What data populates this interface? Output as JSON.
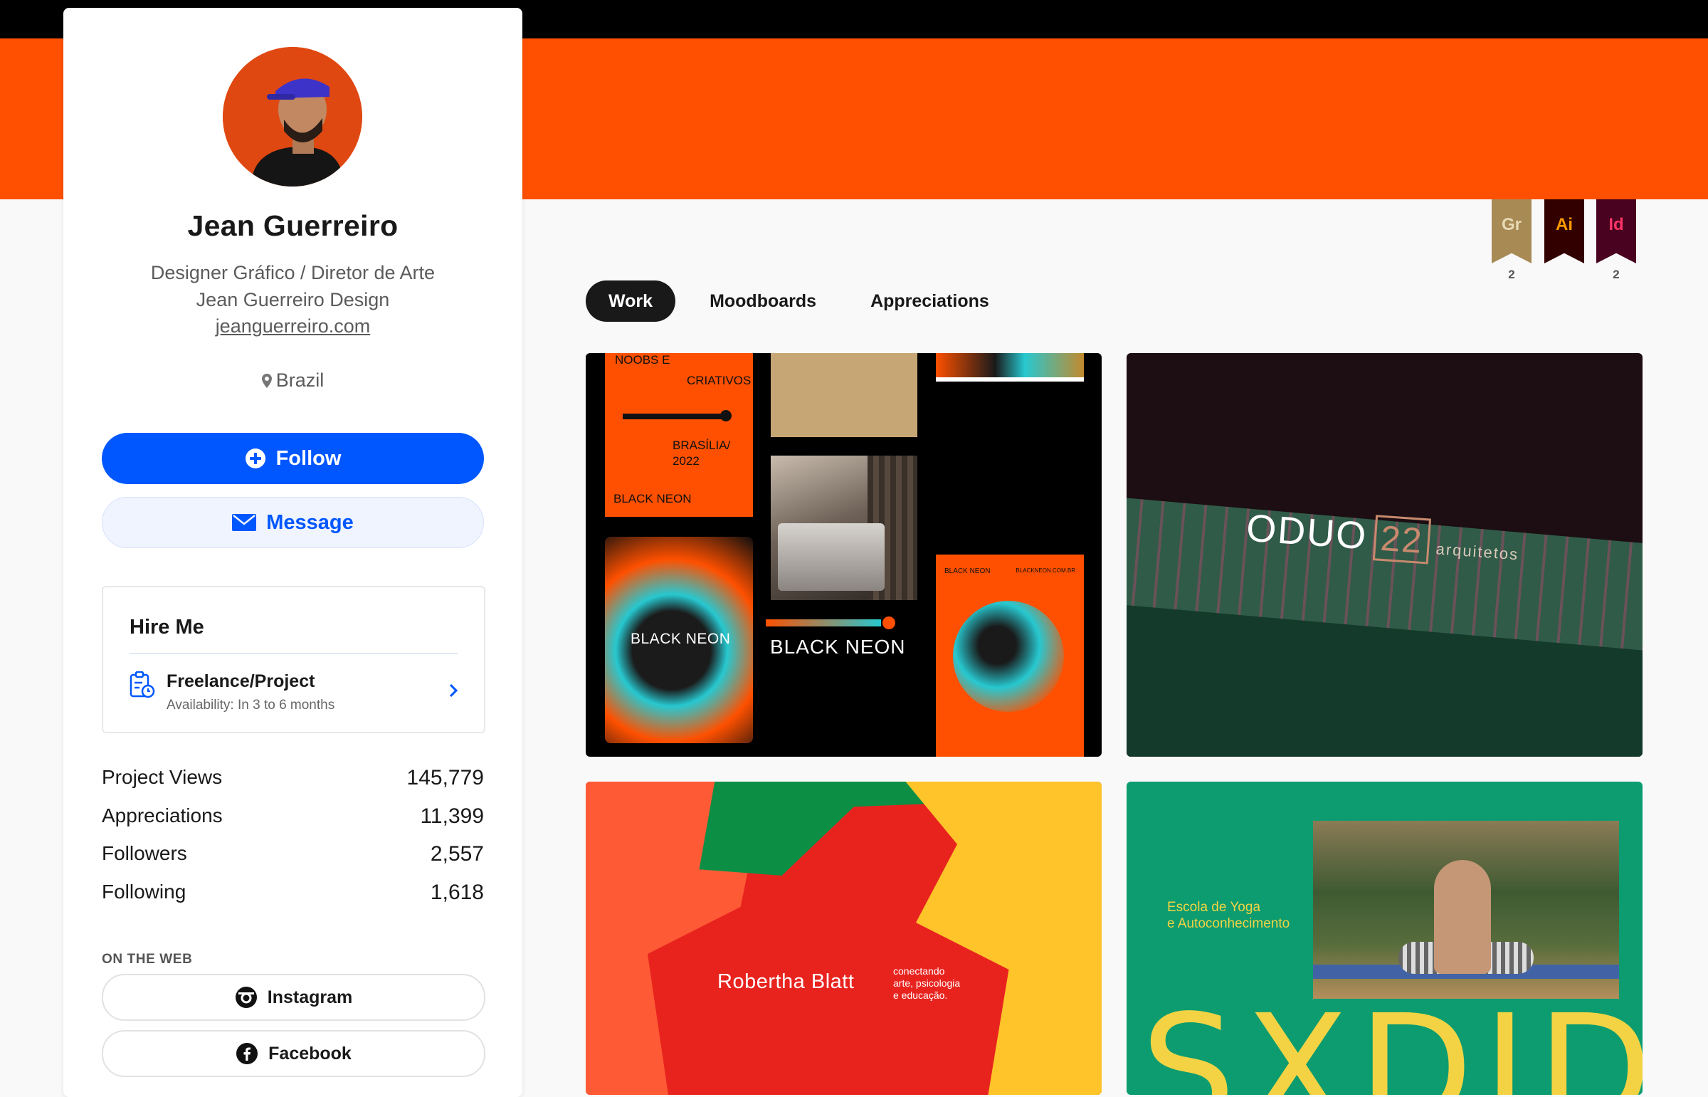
{
  "profile": {
    "name": "Jean Guerreiro",
    "occupation": "Designer Gráfico / Diretor de Arte",
    "company": "Jean Guerreiro Design",
    "website": "jeanguerreiro.com",
    "location": "Brazil"
  },
  "actions": {
    "follow_label": "Follow",
    "message_label": "Message"
  },
  "hire": {
    "title": "Hire Me",
    "option_title": "Freelance/Project",
    "option_sub": "Availability: In 3 to 6 months"
  },
  "stats": [
    {
      "label": "Project Views",
      "value": "145,779"
    },
    {
      "label": "Appreciations",
      "value": "11,399"
    },
    {
      "label": "Followers",
      "value": "2,557"
    },
    {
      "label": "Following",
      "value": "1,618"
    }
  ],
  "on_the_web": {
    "heading": "ON THE WEB",
    "links": [
      {
        "label": "Instagram",
        "icon": "instagram-icon"
      },
      {
        "label": "Facebook",
        "icon": "facebook-icon"
      }
    ]
  },
  "badges": [
    {
      "abbr": "Gr",
      "count": "2",
      "bg": "#a88a55",
      "fg": "#e8d9b5"
    },
    {
      "abbr": "Ai",
      "count": "",
      "bg": "#330000",
      "fg": "#ff9a00"
    },
    {
      "abbr": "Id",
      "count": "2",
      "bg": "#49021f",
      "fg": "#ff3366"
    }
  ],
  "tabs": [
    {
      "label": "Work",
      "active": true
    },
    {
      "label": "Moodboards",
      "active": false
    },
    {
      "label": "Appreciations",
      "active": false
    }
  ],
  "projects": {
    "p1": {
      "noobs": "NOOBS     E",
      "criativos": "CRIATIVOS",
      "brasilia": "BRASÍLIA/ 2022",
      "blackneon_small": "BLACK NEON",
      "poster_text": "BLACK NEON",
      "wordmark": "BLACK NEON",
      "poster2_top_left": "BLACK NEON",
      "poster2_top_right": "BLACKNEON.COM.BR"
    },
    "p2": {
      "brand": "ODUO",
      "num": "22",
      "sub": "arquitetos"
    },
    "p3": {
      "name": "Robertha Blatt",
      "tag1": "conectando",
      "tag2": "arte, psicologia",
      "tag3": "e educação."
    },
    "p4": {
      "line1": "Escola de Yoga",
      "line2": "e Autoconhecimento",
      "big": "SXDID"
    }
  },
  "colors": {
    "banner": "#fe5000",
    "accent": "#0057ff",
    "topbar": "#000000"
  }
}
